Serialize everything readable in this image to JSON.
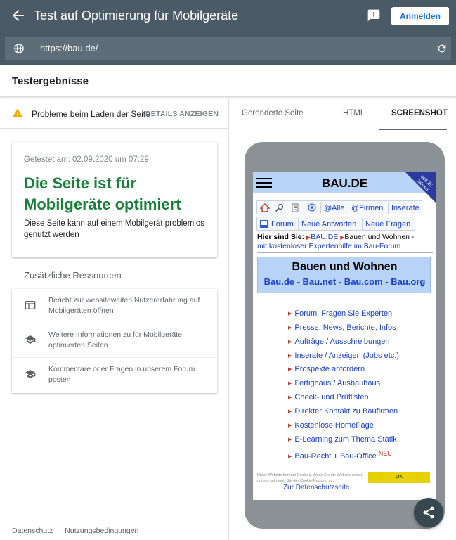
{
  "appbar": {
    "title": "Test auf Optimierung für Mobilgeräte",
    "login_label": "Anmelden",
    "url": "https://bau.de/"
  },
  "results": {
    "heading": "Testergebnisse"
  },
  "left": {
    "warning_text": "Probleme beim Laden der Seite",
    "details_label": "DETAILS ANZEIGEN",
    "tested_at": "Getestet am: 02.09.2020 um 07:29",
    "verdict": "Die Seite ist für Mobilgeräte optimiert",
    "verdict_desc": "Diese Seite kann auf einem Mobilgerät problemlos genutzt werden",
    "resources_title": "Zusätzliche Ressourcen",
    "resources": [
      {
        "icon": "dashboard-icon",
        "text": "Bericht zur websiteweiten Nutzererfahrung auf Mobilgeräten öffnen"
      },
      {
        "icon": "school-icon",
        "text": "Weitere Informationen zu für Mobilgeräte optimierten Seiten"
      },
      {
        "icon": "school-icon",
        "text": "Kommentare oder Fragen in unserem Forum posten"
      }
    ],
    "footer": {
      "privacy": "Datenschutz",
      "terms": "Nutzungsbedingungen"
    }
  },
  "tabs": {
    "rendered": "Gerenderte Seite",
    "html": "HTML",
    "screenshot": "SCREENSHOT",
    "active": "SCREENSHOT"
  },
  "preview": {
    "logo": "BAU.DE",
    "ribbon": "seit 25 Jahren",
    "nav1": [
      "@Alle",
      "@Firmen",
      "Inserate"
    ],
    "nav2": [
      "Forum",
      "Neue Antworten",
      "Neue Fragen"
    ],
    "location_label": "Hier sind Sie:",
    "location_site": "BAU.DE",
    "location_page": "Bauen und Wohnen -",
    "location_sub": "mit kostenloser Expertenhilfe im Bau-Forum",
    "hero_title": "Bauen und Wohnen",
    "hero_sites": "Bau.de - Bau.net - Bau.com - Bau.org",
    "links": [
      "Forum: Fragen Sie Experten",
      "Presse: News, Berichte, Infos",
      "Aufträge / Ausschreibungen",
      "Inserate / Anzeigen (Jobs etc.)",
      "Prospekte anfordern",
      "Fertighaus / Ausbauhaus",
      "Check- und Prüflisten",
      "Direkter Kontakt zu Baufirmen",
      "Kostenlose HomePage",
      "E-Learning zum Thema Statik"
    ],
    "last_link_a": "Bau-Recht",
    "last_link_plus": "+",
    "last_link_b": "Bau-Office",
    "neu": "NEU",
    "cookie_text": "Diese Website benutzt Cookies. Wenn Sie die Website weiter nutzen, stimmen Sie der Cookie-Nutzung zu.",
    "cookie_link": "Zur Datenschutzseite",
    "cookie_ok": "OK"
  },
  "colors": {
    "appbar": "#4a5a66",
    "success": "#188038",
    "link": "#1a3fc6",
    "accent": "#1a73e8"
  }
}
